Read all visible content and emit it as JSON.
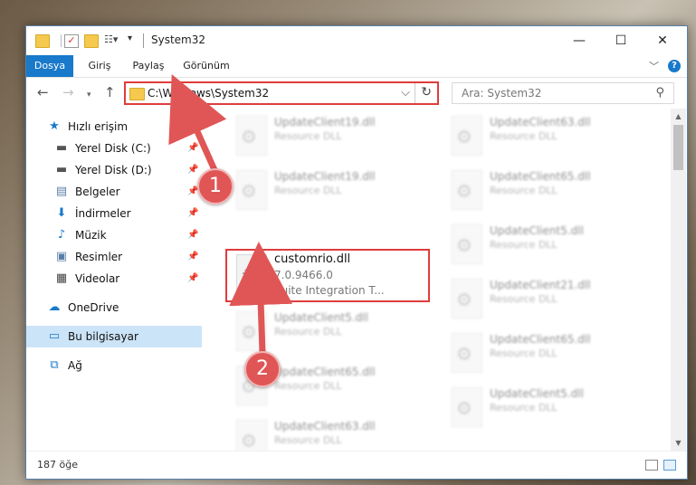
{
  "window": {
    "title": "System32",
    "controls": {
      "minimize": "—",
      "maximize": "☐",
      "close": "✕"
    }
  },
  "ribbon": {
    "tabs": [
      {
        "label": "Dosya",
        "active": true
      },
      {
        "label": "Giriş"
      },
      {
        "label": "Paylaş"
      },
      {
        "label": "Görünüm"
      }
    ],
    "help": "?"
  },
  "nav": {
    "address": "C:\\Windows\\System32",
    "search_placeholder": "Ara: System32"
  },
  "sidebar": {
    "items": [
      {
        "label": "Hızlı erişim",
        "icon": "star-icon",
        "pinned": false
      },
      {
        "label": "Yerel Disk (C:)",
        "icon": "drive-icon",
        "pinned": true
      },
      {
        "label": "Yerel Disk (D:)",
        "icon": "drive-icon",
        "pinned": true
      },
      {
        "label": "Belgeler",
        "icon": "documents-icon",
        "pinned": true
      },
      {
        "label": "İndirmeler",
        "icon": "download-icon",
        "pinned": true
      },
      {
        "label": "Müzik",
        "icon": "music-icon",
        "pinned": true
      },
      {
        "label": "Resimler",
        "icon": "pictures-icon",
        "pinned": true
      },
      {
        "label": "Videolar",
        "icon": "video-icon",
        "pinned": true
      },
      {
        "label": "OneDrive",
        "icon": "cloud-icon",
        "pinned": false
      },
      {
        "label": "Bu bilgisayar",
        "icon": "computer-icon",
        "pinned": false,
        "selected": true
      },
      {
        "label": "Ağ",
        "icon": "network-icon",
        "pinned": false
      }
    ]
  },
  "files": {
    "left": [
      {
        "name": "UpdateClient19.dll",
        "desc": "Resource DLL"
      },
      {
        "name": "UpdateClient19.dll",
        "desc": "Resource DLL"
      },
      {
        "name": "customrio.dll",
        "version": "7.0.9466.0",
        "desc": "Suite Integration T...",
        "highlighted": true
      },
      {
        "name": "UpdateClient5.dll",
        "desc": "Resource DLL"
      },
      {
        "name": "UpdateClient65.dll",
        "desc": "Resource DLL"
      },
      {
        "name": "UpdateClient63.dll",
        "desc": "Resource DLL"
      }
    ],
    "right": [
      {
        "name": "UpdateClient63.dll",
        "desc": "Resource DLL"
      },
      {
        "name": "UpdateClient65.dll",
        "desc": "Resource DLL"
      },
      {
        "name": "UpdateClient5.dll",
        "desc": "Resource DLL"
      },
      {
        "name": "UpdateClient21.dll",
        "desc": "Resource DLL"
      },
      {
        "name": "UpdateClient65.dll",
        "desc": "Resource DLL"
      },
      {
        "name": "UpdateClient5.dll",
        "desc": "Resource DLL"
      }
    ]
  },
  "status": {
    "count": "187 öğe"
  },
  "annotations": {
    "step1": "1",
    "step2": "2"
  },
  "colors": {
    "accent": "#1979ca",
    "annotation": "#e03c3c",
    "selected": "#cce4f7"
  }
}
